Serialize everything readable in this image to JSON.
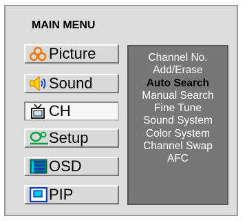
{
  "menu": {
    "title": "MAIN MENU",
    "items": [
      {
        "label": "Picture",
        "icon": "picture-icon"
      },
      {
        "label": "Sound",
        "icon": "speaker-icon"
      },
      {
        "label": "CH",
        "icon": "tv-antenna-icon"
      },
      {
        "label": "Setup",
        "icon": "setup-icon"
      },
      {
        "label": "OSD",
        "icon": "osd-icon"
      },
      {
        "label": "PIP",
        "icon": "pip-icon"
      }
    ],
    "selected": "CH"
  },
  "submenu": {
    "items": [
      "Channel No.",
      "Add/Erase",
      "Auto Search",
      "Manual Search",
      "Fine Tune",
      "Sound System",
      "Color System",
      "Channel Swap",
      "AFC"
    ],
    "active": "Auto Search"
  },
  "colors": {
    "frame_bg": "#dddddd",
    "submenu_bg": "#777777",
    "icon_orange": "#f07800",
    "icon_yellow": "#ffd800",
    "icon_blue": "#1040c0",
    "icon_green": "#00a040",
    "icon_cyan": "#00c8e8"
  }
}
